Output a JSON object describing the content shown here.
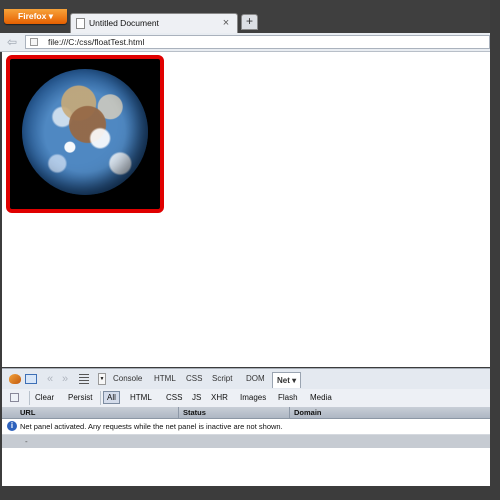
{
  "browser": {
    "menu_button": "Firefox ▾",
    "tab_title": "Untitled Document",
    "tab_close": "×",
    "new_tab": "+",
    "url": "file:///C:/css/floatTest.html",
    "back": "⇦"
  },
  "content": {
    "image": "earth-photo"
  },
  "firebug": {
    "nav_back": "«",
    "nav_forward": "»",
    "tabs": [
      "Console",
      "HTML",
      "CSS",
      "Script",
      "DOM",
      "Net ▾"
    ],
    "active_tab": "Net ▾",
    "net_toolbar": {
      "clear": "Clear",
      "persist": "Persist",
      "filters": [
        "All",
        "HTML",
        "CSS",
        "JS",
        "XHR",
        "Images",
        "Flash",
        "Media"
      ],
      "selected_filter": "All"
    },
    "columns": [
      "URL",
      "Status",
      "Domain"
    ],
    "info_message": "Net panel activated. Any requests while the net panel is inactive are not shown.",
    "status_marker": "-"
  },
  "colors": {
    "firefox_button": "#e66000",
    "highlight_border": "#e00000",
    "info_icon": "#2e62bd"
  }
}
